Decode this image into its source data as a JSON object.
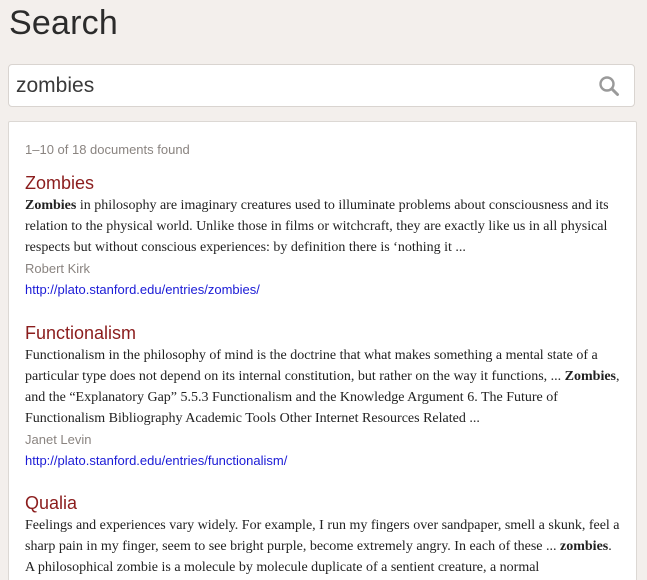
{
  "page": {
    "title": "Search"
  },
  "search": {
    "value": "zombies",
    "placeholder": "",
    "icon": "search-icon"
  },
  "results": {
    "count_text": "1–10 of 18 documents found",
    "items": [
      {
        "title": "Zombies",
        "snippet_parts": [
          {
            "bold": true,
            "text": "Zombies"
          },
          {
            "bold": false,
            "text": " in philosophy are imaginary creatures used to illuminate problems about consciousness and its relation to the physical world. Unlike those in films or witchcraft, they are exactly like us in all physical respects but without conscious experiences: by definition there is ‘nothing it ..."
          }
        ],
        "author": "Robert Kirk",
        "url": "http://plato.stanford.edu/entries/zombies/"
      },
      {
        "title": "Functionalism",
        "snippet_parts": [
          {
            "bold": false,
            "text": "Functionalism in the philosophy of mind is the doctrine that what makes something a mental state of a particular type does not depend on its internal constitution, but rather on the way it functions, ... "
          },
          {
            "bold": true,
            "text": "Zombies"
          },
          {
            "bold": false,
            "text": ", and the “Explanatory Gap” 5.5.3 Functionalism and the Knowledge Argument 6. The Future of Functionalism Bibliography Academic Tools Other Internet Resources Related ..."
          }
        ],
        "author": "Janet Levin",
        "url": "http://plato.stanford.edu/entries/functionalism/"
      },
      {
        "title": "Qualia",
        "snippet_parts": [
          {
            "bold": false,
            "text": "Feelings and experiences vary widely. For example, I run my fingers over sandpaper, smell a skunk, feel a sharp pain in my finger, seem to see bright purple, become extremely angry. In each of these ... "
          },
          {
            "bold": true,
            "text": "zombies"
          },
          {
            "bold": false,
            "text": ". A philosophical zombie is a molecule by molecule duplicate of a sentient creature, a normal"
          }
        ],
        "author": "",
        "url": ""
      }
    ]
  }
}
